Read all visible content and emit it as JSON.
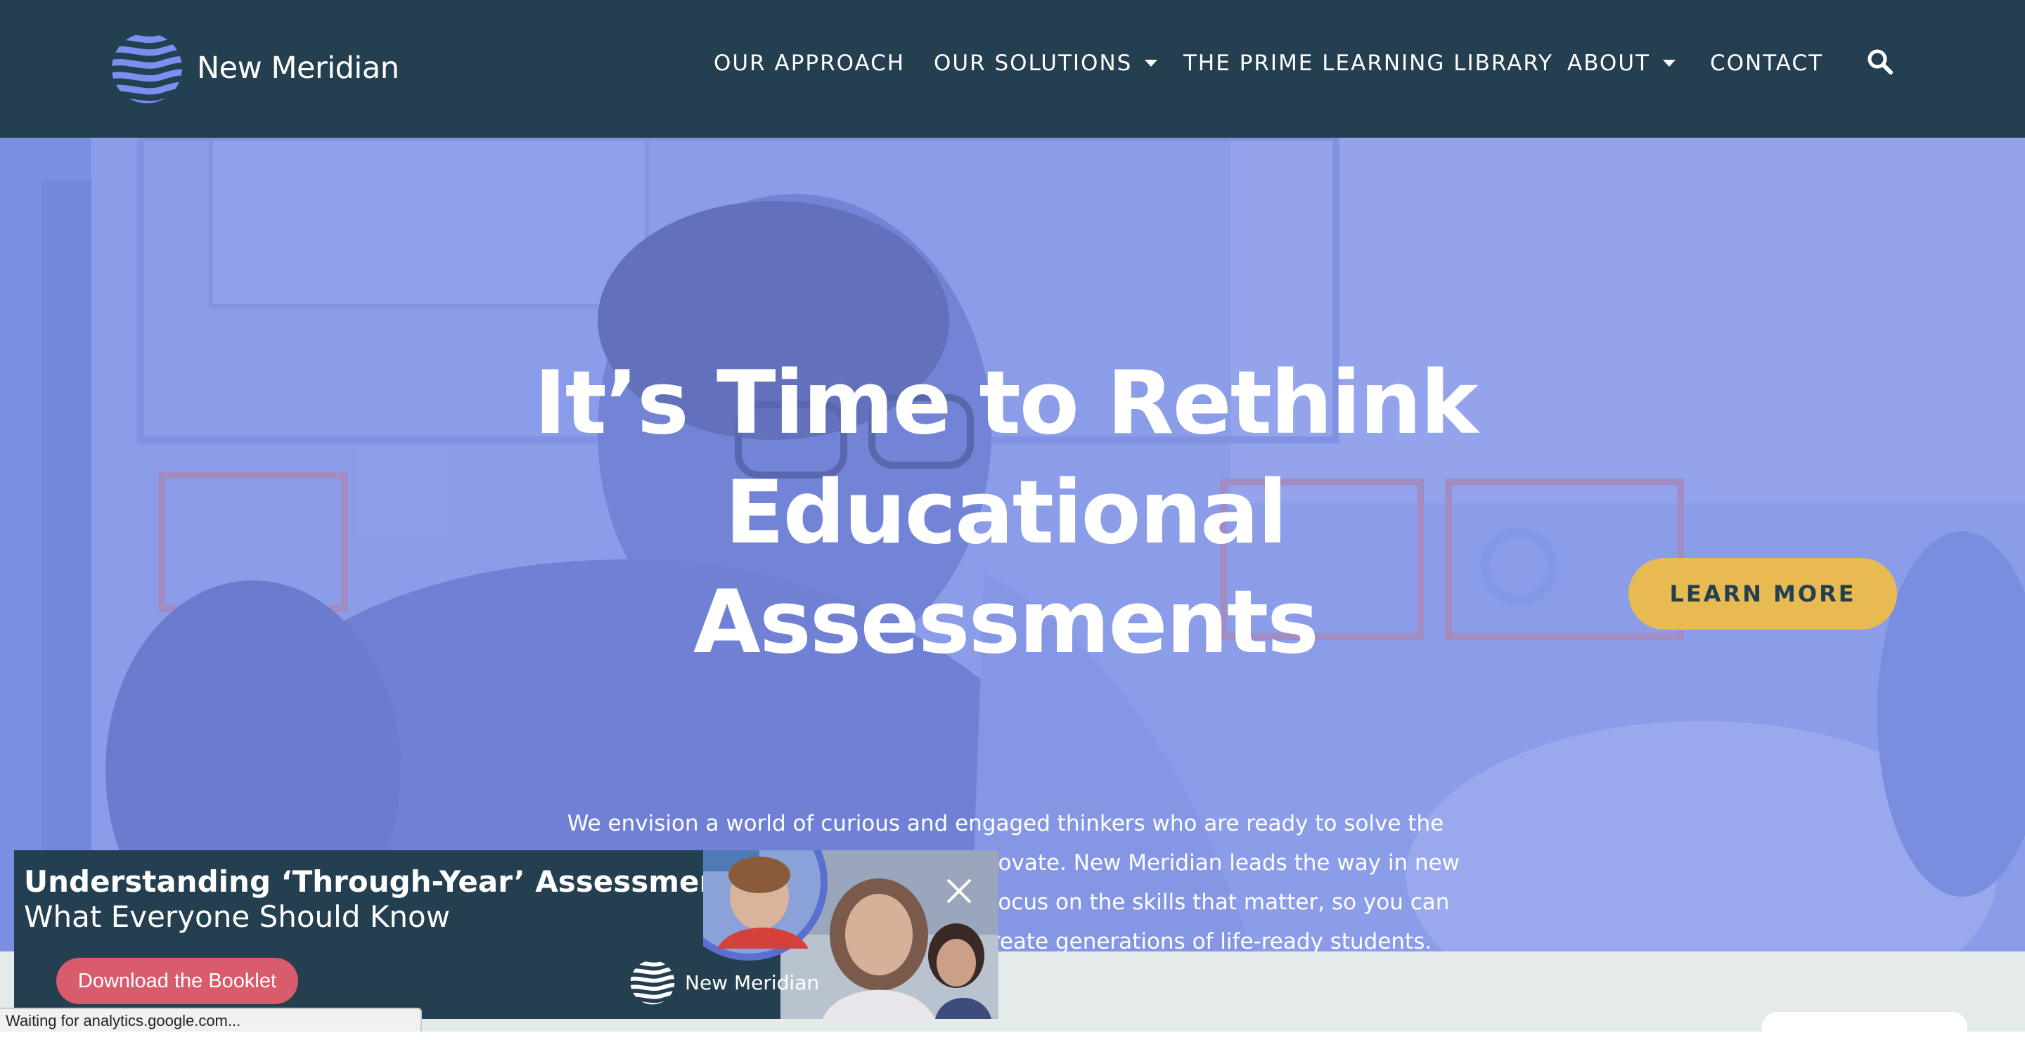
{
  "header": {
    "brand": "New Meridian",
    "nav": [
      {
        "label": "OUR APPROACH",
        "has_dropdown": false
      },
      {
        "label": "OUR SOLUTIONS",
        "has_dropdown": true
      },
      {
        "label": "THE PRIME LEARNING LIBRARY",
        "has_dropdown": false
      },
      {
        "label": "ABOUT",
        "has_dropdown": true
      },
      {
        "label": "CONTACT",
        "has_dropdown": false
      }
    ],
    "search_icon": "search-icon"
  },
  "hero": {
    "title": "It’s Time to Rethink Educational Assessments",
    "description": "We envision a world of curious and engaged thinkers who are ready to solve the problems of tomorrow. To do that, we innovate. New Meridian leads the way in new high-quality assessment solutions that focus on the skills that matter, so you can modernize without compromise and create generations of life-ready students.",
    "cta_label": "LEARN MORE"
  },
  "promo": {
    "title": "Understanding ‘Through-Year’ Assessment:",
    "subtitle": "What Everyone Should Know",
    "cta_label": "Download the Booklet",
    "brand": "New Meridian",
    "close_icon": "close-icon"
  },
  "status_bar": {
    "text": "Waiting for analytics.google.com..."
  },
  "colors": {
    "header_bg": "#243f4f",
    "hero_tint": "#8e9ee8",
    "accent_yellow": "#e8bb52",
    "promo_button": "#d95c6c",
    "logo_blue": "#7b8ff0"
  }
}
